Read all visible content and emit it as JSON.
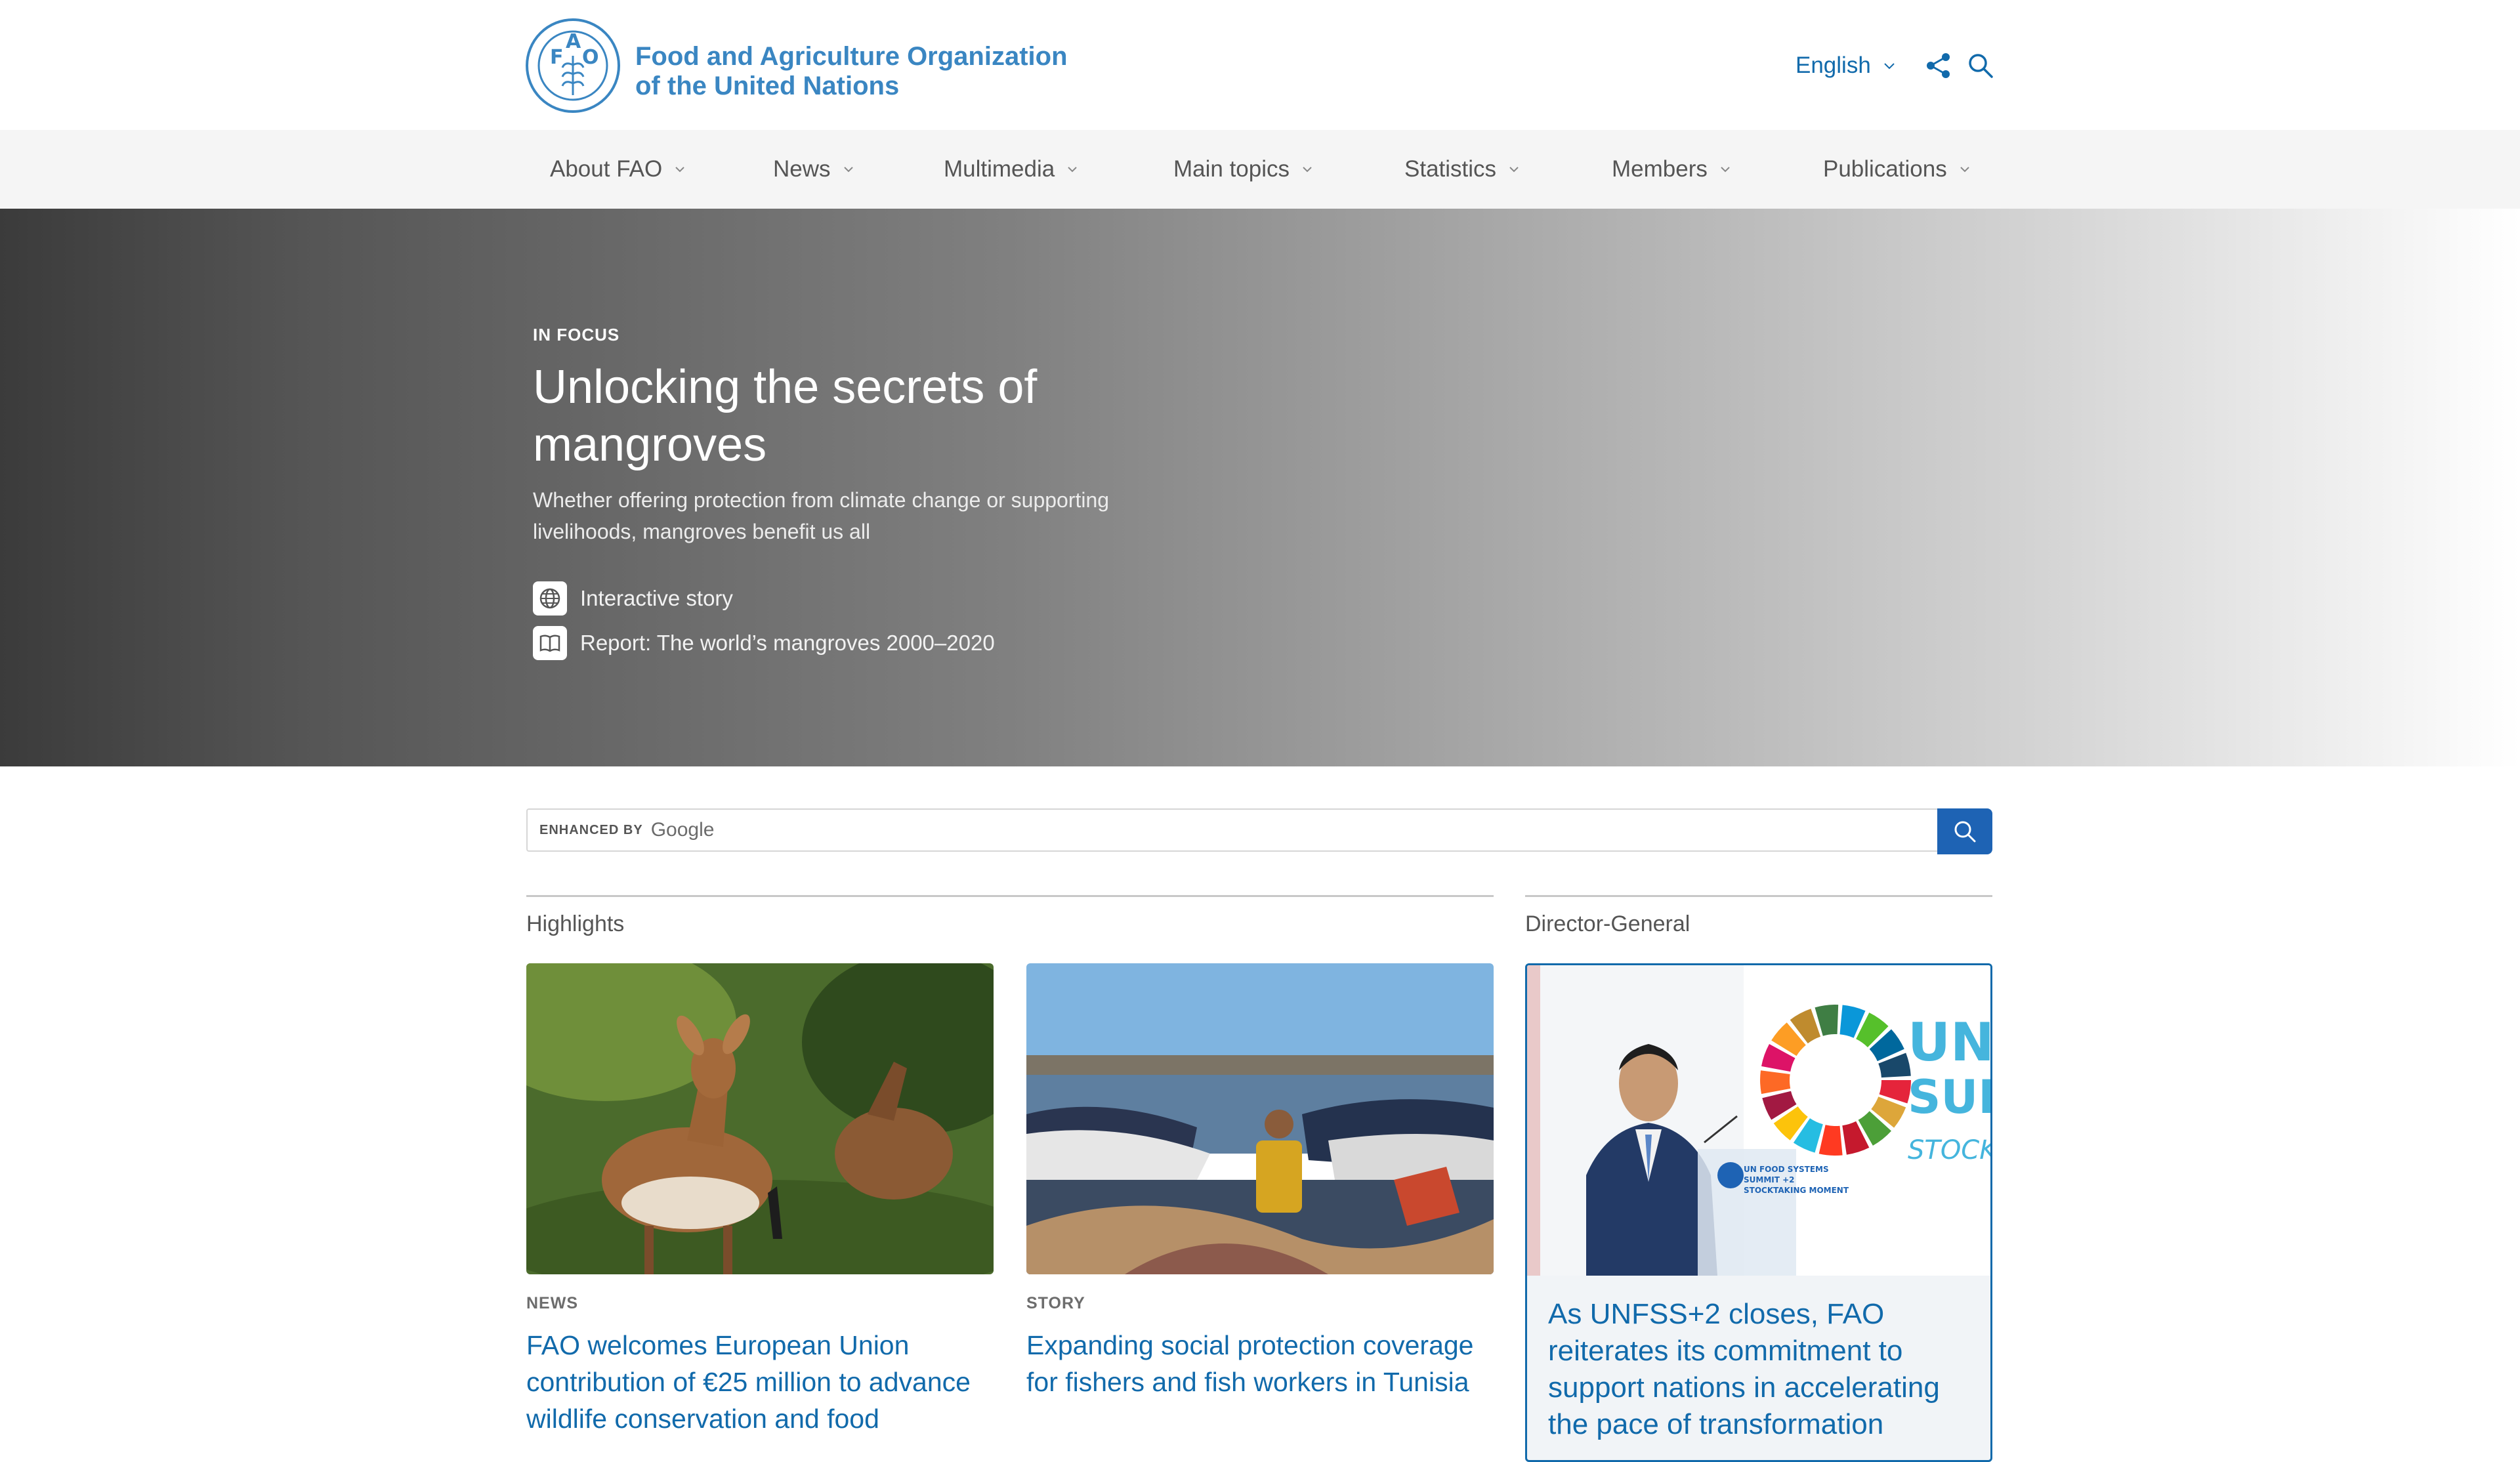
{
  "header": {
    "logo_line1": "Food and Agriculture Organization",
    "logo_line2": "of the United Nations",
    "language": "English"
  },
  "nav": {
    "items": [
      {
        "label": "About FAO"
      },
      {
        "label": "News"
      },
      {
        "label": "Multimedia"
      },
      {
        "label": "Main topics"
      },
      {
        "label": "Statistics"
      },
      {
        "label": "Members"
      },
      {
        "label": "Publications"
      }
    ]
  },
  "hero": {
    "kicker": "IN FOCUS",
    "title": "Unlocking the secrets of mangroves",
    "description": "Whether offering protection from climate change or supporting livelihoods, mangroves benefit us all",
    "links": [
      {
        "label": "Interactive story",
        "icon": "globe-icon"
      },
      {
        "label": "Report: The world’s mangroves 2000–2020",
        "icon": "open-book-icon"
      }
    ]
  },
  "search": {
    "enhanced_by": "ENHANCED BY",
    "provider": "Google"
  },
  "highlights": {
    "heading": "Highlights",
    "cards": [
      {
        "type": "NEWS",
        "title": "FAO welcomes European Union contribution of €25 million to advance wildlife conservation and food"
      },
      {
        "type": "STORY",
        "title": "Expanding social protection coverage for fishers and fish workers in Tunisia"
      }
    ]
  },
  "director_general": {
    "heading": "Director-General",
    "banner_text_1": "UN FO",
    "banner_text_2": "SUMI",
    "banner_text_3": "STOCKT",
    "podium_sign": "UN FOOD SYSTEMS SUMMIT +2 STOCKTAKING MOMENT",
    "card_title": "As UNFSS+2 closes, FAO reiterates its commitment to support nations in accelerating the pace of transformation"
  },
  "colors": {
    "brand_blue": "#116aab",
    "logo_blue": "#3a86c2",
    "nav_bg": "#f5f5f5",
    "search_button": "#1e63b4"
  }
}
